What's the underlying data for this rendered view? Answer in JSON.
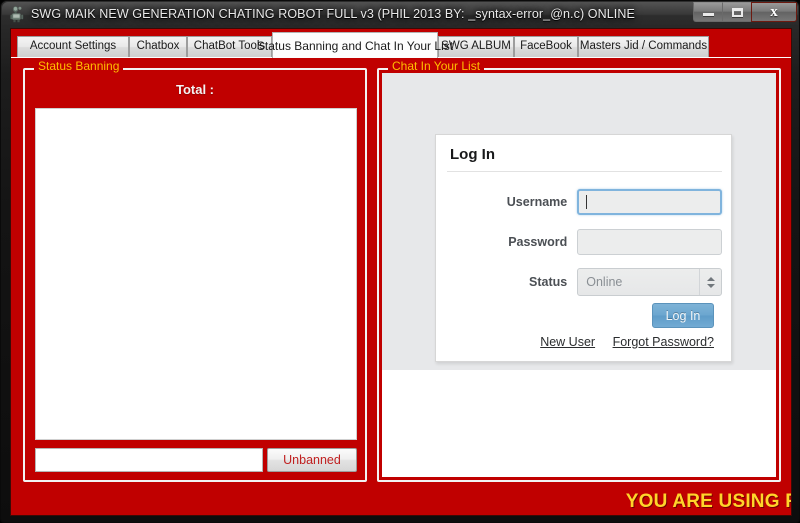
{
  "window": {
    "title": "SWG MAIK NEW GENERATION CHATING ROBOT FULL v3 (PHIL 2013 BY: _syntax-error_@n.c)    ONLINE",
    "icon": "robot-icon",
    "controls": {
      "minimize_label": "",
      "maximize_label": "",
      "close_label": "x"
    }
  },
  "tabs": [
    {
      "label": "Account Settings",
      "active": false
    },
    {
      "label": "Chatbox",
      "active": false
    },
    {
      "label": "ChatBot Tools",
      "active": false
    },
    {
      "label": "Status Banning and Chat In Your List",
      "active": true
    },
    {
      "label": "SWG ALBUM",
      "active": false
    },
    {
      "label": "FaceBook",
      "active": false
    },
    {
      "label": "Masters Jid / Commands",
      "active": false
    }
  ],
  "status_banning": {
    "group_title": "Status Banning",
    "total_label": "Total :",
    "list_items": [],
    "unban_input_value": "",
    "unban_input_placeholder": "",
    "unbanned_button_label": "Unbanned"
  },
  "chat_in_your_list": {
    "group_title": "Chat In Your List",
    "login_form": {
      "heading": "Log In",
      "username_label": "Username",
      "username_value": "",
      "password_label": "Password",
      "password_value": "",
      "status_label": "Status",
      "status_value": "Online",
      "status_options": [
        "Online"
      ],
      "submit_label": "Log In",
      "new_user_link": "New User",
      "forgot_password_link": "Forgot Password?"
    }
  },
  "bottom_bar": {
    "marquee_text": "YOU ARE USING F"
  },
  "colors": {
    "app_red": "#c00000",
    "group_title_yellow": "#ffbe00",
    "marquee_yellow": "#ffd42a",
    "unbanned_text_red": "#c02020",
    "login_button_blue": "#6ba6cf",
    "focus_border_blue": "#80b4dd",
    "browser_gray": "#e7e8ea"
  }
}
